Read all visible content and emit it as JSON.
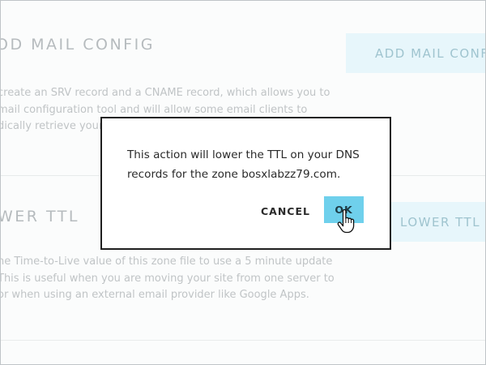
{
  "background": {
    "mail_config": {
      "title": "OD MAIL CONFIG",
      "button_label": "ADD MAIL CONFI",
      "description_lines": [
        "create an SRV record and a CNAME record, which allows you to",
        "mail configuration tool and will allow some email clients to",
        "dically retrieve your"
      ]
    },
    "lower_ttl": {
      "title": "WER TTL",
      "button_label": "LOWER TTL",
      "description_lines": [
        "he Time-to-Live value of this zone file to use a 5 minute update",
        "This is useful when you are moving your site from one server to",
        "or when using an external email provider like Google Apps."
      ]
    }
  },
  "modal": {
    "message_lines": [
      "This action will lower the TTL on your DNS",
      "records for the zone bosxlabzz79.com."
    ],
    "cancel_label": "CANCEL",
    "ok_label": "OK"
  },
  "colors": {
    "ok_button": "#6fd0ec",
    "modal_border": "#1f1f1f",
    "background_button": "#e7f6fb"
  },
  "icons": {
    "cursor": "hand-pointer-icon"
  }
}
